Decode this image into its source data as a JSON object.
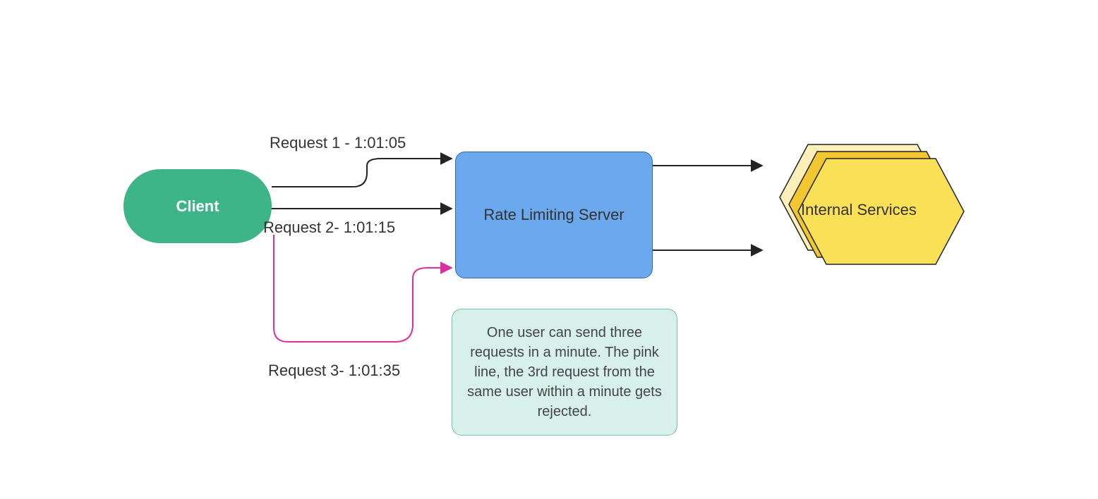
{
  "nodes": {
    "client": {
      "label": "Client"
    },
    "server": {
      "label": "Rate Limiting Server"
    },
    "services": {
      "label": "Internal Services"
    }
  },
  "requests": {
    "r1": {
      "label": "Request 1 - 1:01:05"
    },
    "r2": {
      "label": "Request 2- 1:01:15"
    },
    "r3": {
      "label": "Request 3- 1:01:35"
    }
  },
  "note": {
    "text": "One user can send three requests in a minute. The pink line, the 3rd request from the same user within a minute gets rejected."
  },
  "colors": {
    "client_fill": "#3eb489",
    "server_fill": "#6ba8ed",
    "server_border": "#2d6ab5",
    "note_fill": "#d8f0ea",
    "note_border": "#6fbfae",
    "hex_fill_back": "#fcefb8",
    "hex_fill_mid": "#f0c730",
    "hex_fill_front": "#fae056",
    "arrow_normal": "#242424",
    "arrow_reject": "#d930a0"
  }
}
